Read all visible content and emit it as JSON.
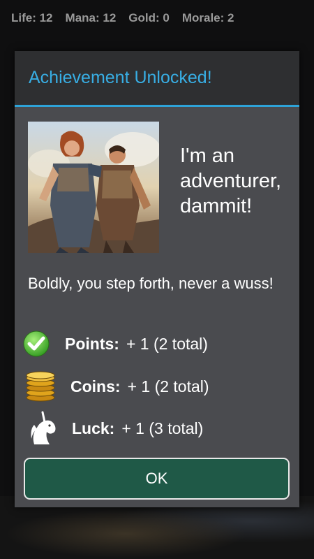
{
  "status": {
    "life": "Life: 12",
    "mana": "Mana: 12",
    "gold": "Gold: 0",
    "morale": "Morale: 2"
  },
  "dialog": {
    "title": "Achievement Unlocked!",
    "achievement_name": "I'm an adventurer, dammit!",
    "description": "Boldly, you step forth, never a wuss!",
    "rewards": [
      {
        "icon": "checkmark-icon",
        "label": "Points:",
        "value": "+ 1 (2 total)"
      },
      {
        "icon": "coins-icon",
        "label": "Coins:",
        "value": "+ 1 (2 total)"
      },
      {
        "icon": "unicorn-icon",
        "label": "Luck:",
        "value": "+ 1 (3 total)"
      }
    ],
    "ok_label": "OK"
  },
  "colors": {
    "title": "#38aee4",
    "accent_line": "#2ea3d8",
    "ok_button": "#1f5947"
  }
}
